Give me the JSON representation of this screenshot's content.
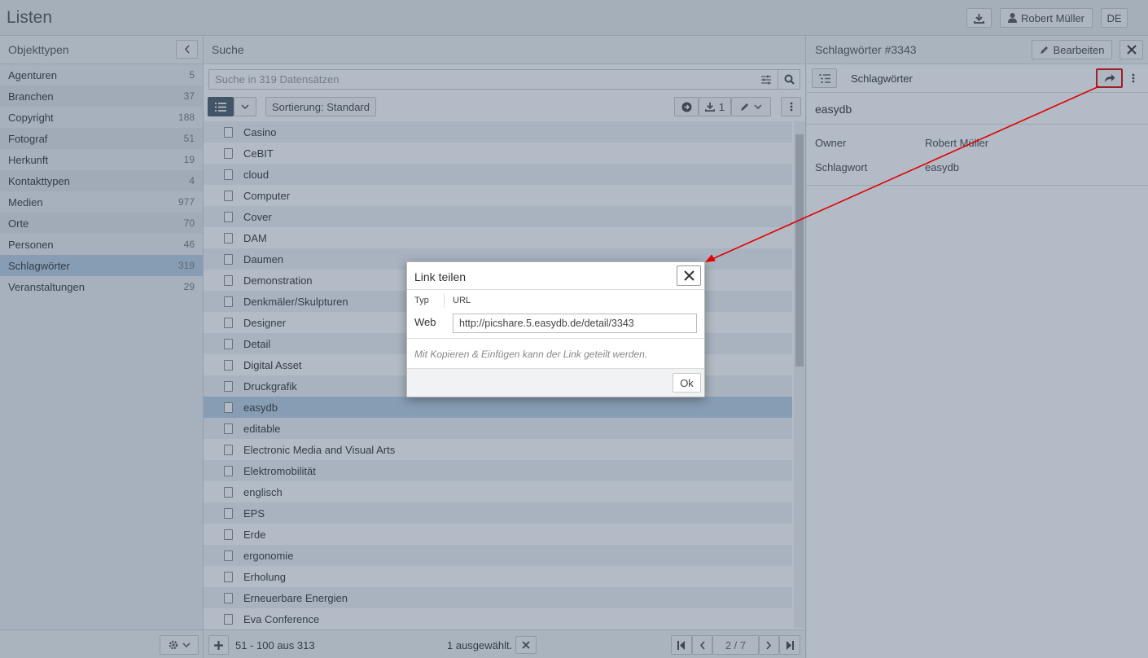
{
  "app": {
    "title": "Listen",
    "download_icon": "download-icon",
    "user": "Robert Müller",
    "lang": "DE"
  },
  "left": {
    "header": "Objekttypen",
    "items": [
      {
        "label": "Agenturen",
        "count": "5"
      },
      {
        "label": "Branchen",
        "count": "37"
      },
      {
        "label": "Copyright",
        "count": "188"
      },
      {
        "label": "Fotograf",
        "count": "51"
      },
      {
        "label": "Herkunft",
        "count": "19"
      },
      {
        "label": "Kontakttypen",
        "count": "4"
      },
      {
        "label": "Medien",
        "count": "977"
      },
      {
        "label": "Orte",
        "count": "70"
      },
      {
        "label": "Personen",
        "count": "46"
      },
      {
        "label": "Schlagwörter",
        "count": "319"
      },
      {
        "label": "Veranstaltungen",
        "count": "29"
      }
    ]
  },
  "mid": {
    "header": "Suche",
    "search_placeholder": "Suche in 319 Datensätzen",
    "sort": "Sortierung: Standard",
    "download_count": "1",
    "rows": [
      "Casino",
      "CeBIT",
      "cloud",
      "Computer",
      "Cover",
      "DAM",
      "Daumen",
      "Demonstration",
      "Denkmäler/Skulpturen",
      "Designer",
      "Detail",
      "Digital Asset",
      "Druckgrafik",
      "easydb",
      "editable",
      "Electronic Media and Visual Arts",
      "Elektromobilität",
      "englisch",
      "EPS",
      "Erde",
      "ergonomie",
      "Erholung",
      "Erneuerbare Energien",
      "Eva Conference"
    ],
    "selected_index": 13,
    "range": "51 - 100 aus 313",
    "selected_text": "1 ausgewählt.",
    "page": "2 / 7"
  },
  "right": {
    "header": "Schlagwörter #3343",
    "edit": "Bearbeiten",
    "sub": "Schlagwörter",
    "name": "easydb",
    "fields": [
      {
        "key": "Owner",
        "value": "Robert Müller"
      },
      {
        "key": "Schlagwort",
        "value": "easydb"
      }
    ]
  },
  "dialog": {
    "title": "Link teilen",
    "col_type": "Typ",
    "col_url": "URL",
    "row_label": "Web",
    "url": "http://picshare.5.easydb.de/detail/3343",
    "hint": "Mit Kopieren & Einfügen kann der Link geteilt werden.",
    "ok": "Ok"
  },
  "colors": {
    "highlight": "#e00000",
    "selected": "#b9cde3"
  }
}
